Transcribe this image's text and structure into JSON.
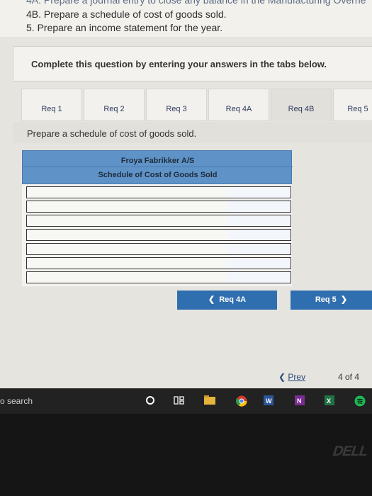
{
  "instructions": [
    "4A. Prepare a journal entry to close any balance in the Manufacturing Overhe",
    "4B. Prepare a schedule of cost of goods sold.",
    "5. Prepare an income statement for the year."
  ],
  "panel_text": "Complete this question by entering your answers in the tabs below.",
  "tabs": [
    {
      "label": "Req 1"
    },
    {
      "label": "Req 2"
    },
    {
      "label": "Req 3"
    },
    {
      "label": "Req 4A"
    },
    {
      "label": "Req 4B"
    },
    {
      "label": "Req 5"
    }
  ],
  "prompt": "Prepare a schedule of cost of goods sold.",
  "table": {
    "company": "Froya Fabrikker A/S",
    "title": "Schedule of Cost of Goods Sold"
  },
  "buttons": {
    "prev_label": "Req 4A",
    "next_label": "Req 5"
  },
  "pager": {
    "prev_label": "Prev",
    "count": "4 of 4"
  },
  "taskbar": {
    "search_text": "o search"
  },
  "brand": "DELL",
  "colors": {
    "accent": "#2f6fb0",
    "table_header": "#5f93c7"
  }
}
